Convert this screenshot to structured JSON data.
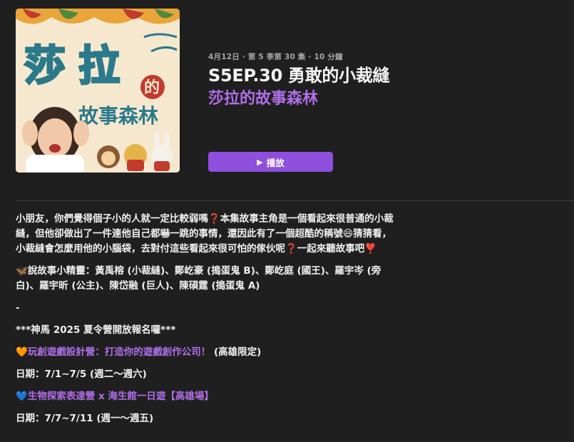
{
  "artwork": {
    "title_chars": [
      "莎",
      "拉",
      "的"
    ],
    "subtitle": "故事森林"
  },
  "episode": {
    "meta": "4月12日 · 第 5 季第 30 集 · 10 分鐘",
    "title": "S5EP.30 勇敢的小裁縫",
    "show": "莎拉的故事森林"
  },
  "play_button": {
    "icon": "play-icon",
    "label": "播放"
  },
  "description": {
    "intro": "小朋友，你們覺得個子小的人就一定比較弱嗎❓本集故事主角是一個看起來很普通的小裁縫，但他卻做出了一件連他自己都嚇一跳的事情，還因此有了一個超酷的稱號😆猜猜看，小裁縫會怎麼用他的小腦袋，去對付這些看起來很可怕的傢伙呢❓一起來聽故事吧❣️",
    "cast_emoji": "🦋",
    "cast": "說故事小精靈：黃禹榕 (小裁縫)、鄭屹豪 (搗蛋鬼 B)、鄭屹庭 (國王)、羅宇岑 (旁白)、羅宇昕 (公主)、陳岱融 (巨人)、陳碩霆 (搗蛋鬼 A)",
    "separator": "-",
    "announcement": "***神馬 2025 夏令營開放報名囉***",
    "camp1_emoji": "🧡",
    "camp1_link": "玩創遊戲設計營：打造你的遊戲創作公司！",
    "camp1_note": " (高雄限定)",
    "camp1_date": "日期：7/1~7/5 (週二～週六)",
    "camp2_emoji": "💙",
    "camp2_link": "生物探索表達營 x 海生館一日遊【高雄場】",
    "camp2_date": "日期：7/7~7/11 (週一～週五)"
  },
  "colors": {
    "background": "#1f1f1f",
    "accent": "#8e4fdd",
    "link": "#b06ee8",
    "artwork_bg": "#f6e8cf",
    "artwork_title": "#2b7a8c"
  }
}
